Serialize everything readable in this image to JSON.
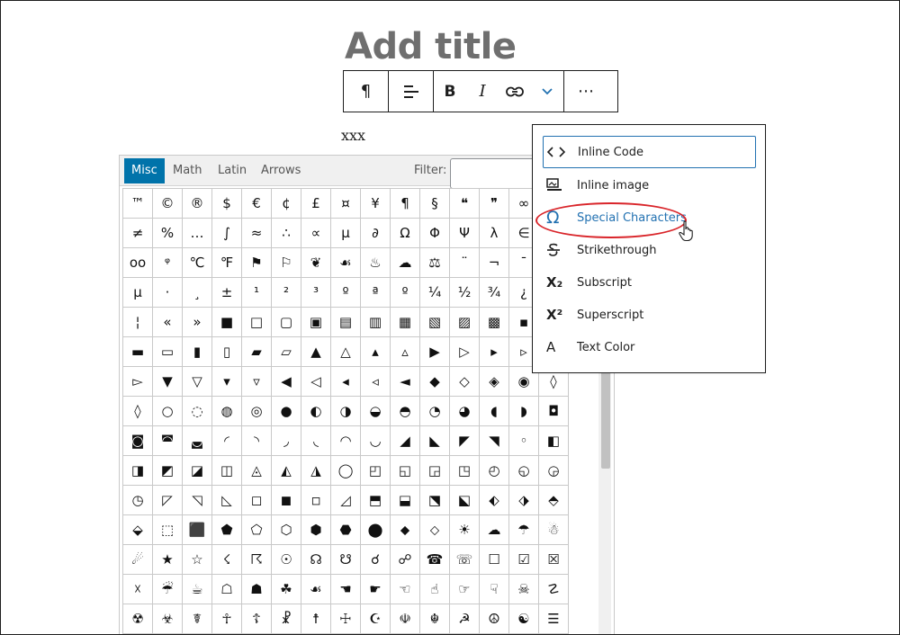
{
  "editor": {
    "title_placeholder": "Add title",
    "paragraph_text": "xxx"
  },
  "toolbar": {
    "paragraph_icon": "¶",
    "align_icon": "align-left-icon",
    "bold_label": "B",
    "italic_label": "I",
    "link_icon": "link-icon",
    "more_rich_text_icon": "chevron-down-icon",
    "options_label": "⋯"
  },
  "charmap": {
    "tabs": [
      "Misc",
      "Math",
      "Latin",
      "Arrows"
    ],
    "active_tab": "Misc",
    "filter_label": "Filter:",
    "filter_value": "",
    "rows": [
      [
        "™",
        "©",
        "®",
        "$",
        "€",
        "¢",
        "£",
        "¤",
        "¥",
        "¶",
        "§",
        "❝",
        "❞",
        "∞",
        "‰"
      ],
      [
        "≠",
        "%",
        "…",
        "∫",
        "≈",
        "∴",
        "∝",
        "µ",
        "∂",
        "Ω",
        "Φ",
        "Ψ",
        "λ",
        "∈",
        "∉"
      ],
      [
        "oo",
        "ᵠ",
        "℃",
        "℉",
        "⚑",
        "⚐",
        "❦",
        "☙",
        "♨",
        "☁",
        "⚖",
        "¨",
        "¬",
        "¯",
        "°"
      ],
      [
        "µ",
        "·",
        "¸",
        "±",
        "¹",
        "²",
        "³",
        "º",
        "ª",
        "º",
        "¼",
        "½",
        "¾",
        "¿",
        "¡"
      ],
      [
        "¦",
        "«",
        "»",
        "■",
        "□",
        "▢",
        "▣",
        "▤",
        "▥",
        "▦",
        "▧",
        "▨",
        "▩",
        "▪",
        "▫"
      ],
      [
        "▬",
        "▭",
        "▮",
        "▯",
        "▰",
        "▱",
        "▲",
        "△",
        "▴",
        "▵",
        "▶",
        "▷",
        "▸",
        "▹",
        "►"
      ],
      [
        "▻",
        "▼",
        "▽",
        "▾",
        "▿",
        "◀",
        "◁",
        "◂",
        "◃",
        "◄",
        "◆",
        "◇",
        "◈",
        "◉",
        "◊"
      ],
      [
        "◊",
        "○",
        "◌",
        "◍",
        "◎",
        "●",
        "◐",
        "◑",
        "◒",
        "◓",
        "◔",
        "◕",
        "◖",
        "◗",
        "◘"
      ],
      [
        "◙",
        "◚",
        "◛",
        "◜",
        "◝",
        "◞",
        "◟",
        "◠",
        "◡",
        "◢",
        "◣",
        "◤",
        "◥",
        "◦",
        "◧"
      ],
      [
        "◨",
        "◩",
        "◪",
        "◫",
        "◬",
        "◭",
        "◮",
        "◯",
        "◰",
        "◱",
        "◲",
        "◳",
        "◴",
        "◵",
        "◶"
      ],
      [
        "◷",
        "◸",
        "◹",
        "◺",
        "◻",
        "◼",
        "◽",
        "◿",
        "⬒",
        "⬓",
        "⬔",
        "⬕",
        "⬖",
        "⬗",
        "⬘"
      ],
      [
        "⬙",
        "⬚",
        "⬛",
        "⬟",
        "⬠",
        "⬡",
        "⬢",
        "⬣",
        "⬤",
        "⬥",
        "⬦",
        "☀",
        "☁",
        "☂",
        "☃"
      ],
      [
        "☄",
        "★",
        "☆",
        "☇",
        "☈",
        "☉",
        "☊",
        "☋",
        "☌",
        "☍",
        "☎",
        "☏",
        "☐",
        "☑",
        "☒"
      ],
      [
        "☓",
        "☔",
        "☕",
        "☖",
        "☗",
        "☘",
        "☙",
        "☚",
        "☛",
        "☜",
        "☝",
        "☞",
        "☟",
        "☠",
        "☡"
      ],
      [
        "☢",
        "☣",
        "☤",
        "☥",
        "☦",
        "☧",
        "☨",
        "☩",
        "☪",
        "☫",
        "☬",
        "☭",
        "☮",
        "☯",
        "☰"
      ]
    ]
  },
  "menu": {
    "items": [
      {
        "icon": "<>",
        "label": "Inline Code"
      },
      {
        "icon": "inline-image-icon",
        "label": "Inline image"
      },
      {
        "icon": "Ω",
        "label": "Special Characters"
      },
      {
        "icon": "strikethrough-icon",
        "label": "Strikethrough"
      },
      {
        "icon": "X₂",
        "label": "Subscript"
      },
      {
        "icon": "X²",
        "label": "Superscript"
      },
      {
        "icon": "A",
        "label": "Text Color"
      }
    ]
  },
  "colors": {
    "accent": "#2271b1",
    "active_tab": "#0073aa",
    "annotation": "#d9252a"
  }
}
